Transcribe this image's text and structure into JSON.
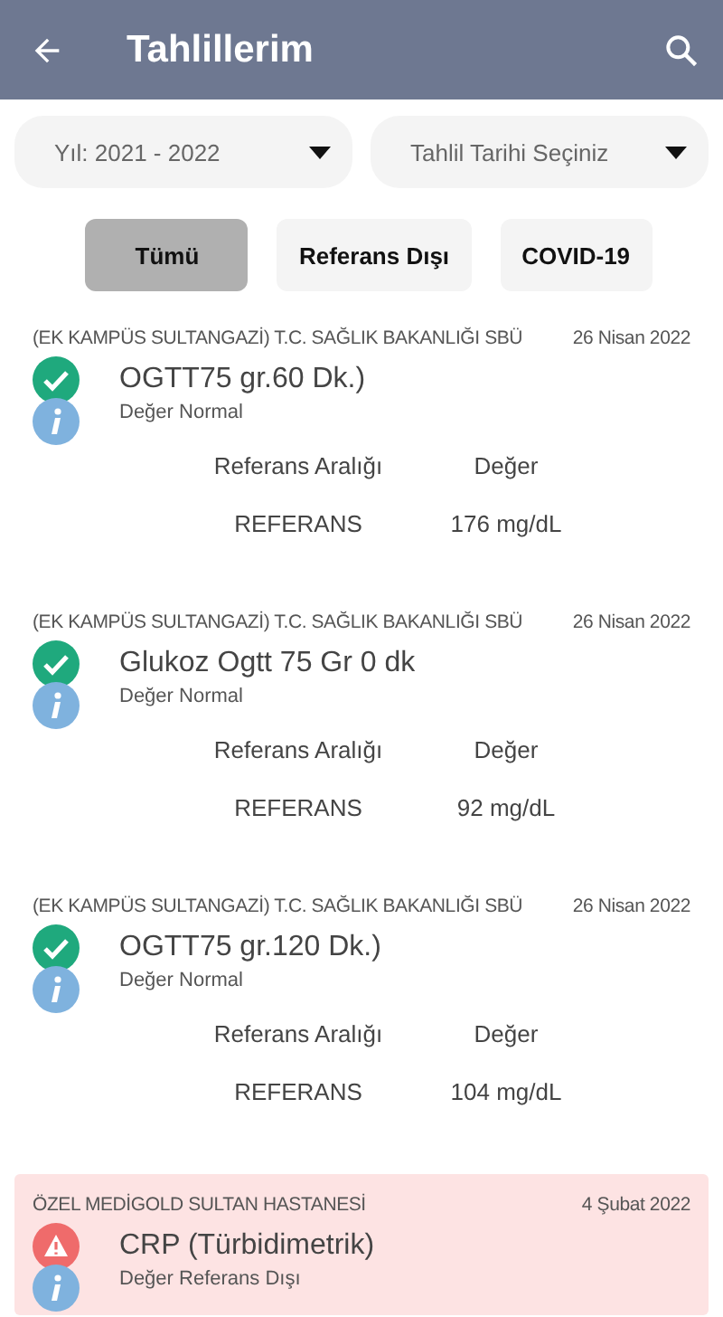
{
  "app_bar": {
    "title": "Tahlillerim"
  },
  "dropdowns": [
    {
      "value": "Yıl: 2021 - 2022"
    },
    {
      "value": "Tahlil Tarihi Seçiniz"
    }
  ],
  "filters": [
    {
      "label": "Tümü",
      "selected": true
    },
    {
      "label": "Referans Dışı",
      "selected": false
    },
    {
      "label": "COVID-19",
      "selected": false
    }
  ],
  "results": [
    {
      "kind": "normal",
      "hospital": "(EK KAMPÜS SULTANGAZİ) T.C. SAĞLIK BAKANLIĞI SBÜ",
      "date": "26 Nisan 2022",
      "test": "OGTT75 gr.60 Dk.)",
      "status": "Değer Normal",
      "range_header": "Referans Aralığı",
      "value_header": "Değer",
      "range": "REFERANS",
      "value": "176 mg/dL"
    },
    {
      "kind": "normal",
      "hospital": "(EK KAMPÜS SULTANGAZİ) T.C. SAĞLIK BAKANLIĞI SBÜ",
      "date": "26 Nisan 2022",
      "test": "Glukoz Ogtt 75 Gr 0 dk",
      "status": "Değer Normal",
      "range_header": "Referans Aralığı",
      "value_header": "Değer",
      "range": "REFERANS",
      "value": "92 mg/dL"
    },
    {
      "kind": "normal",
      "hospital": "(EK KAMPÜS SULTANGAZİ) T.C. SAĞLIK BAKANLIĞI SBÜ",
      "date": "26 Nisan 2022",
      "test": "OGTT75 gr.120 Dk.)",
      "status": "Değer Normal",
      "range_header": "Referans Aralığı",
      "value_header": "Değer",
      "range": "REFERANS",
      "value": "104 mg/dL"
    },
    {
      "kind": "abnormal",
      "hospital": "ÖZEL MEDİGOLD SULTAN HASTANESİ",
      "date": "4 Şubat 2022",
      "test": "CRP (Türbidimetrik)",
      "status": "Değer Referans Dışı"
    }
  ]
}
